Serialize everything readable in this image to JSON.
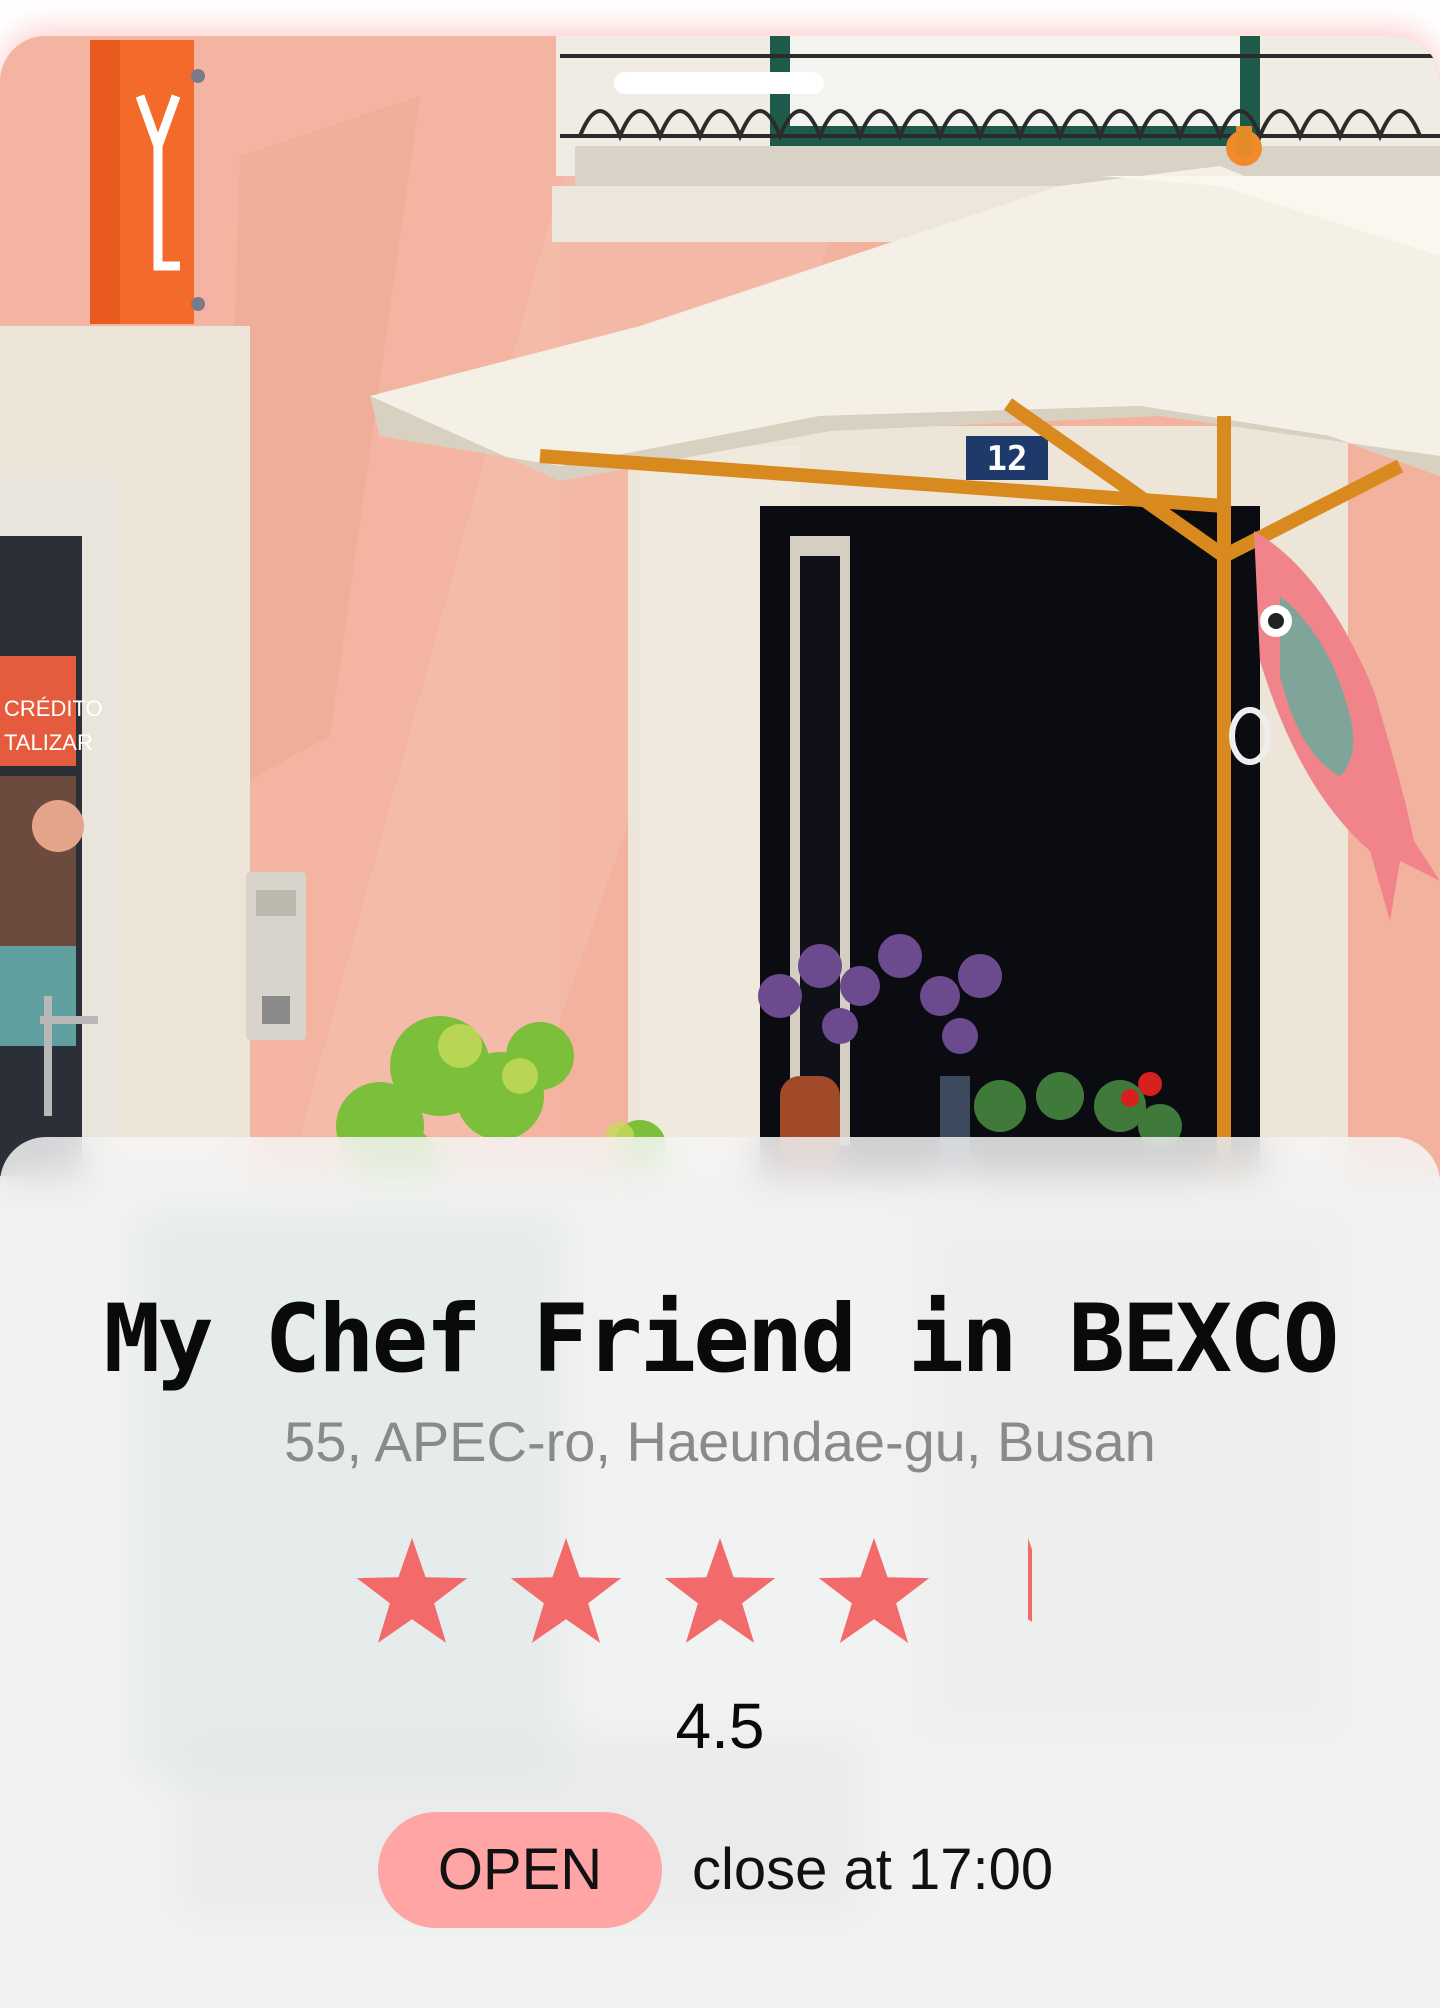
{
  "restaurant": {
    "name": "My Chef Friend in BEXCO",
    "address": "55, APEC-ro, Haeundae-gu, Busan",
    "rating": 4.5,
    "rating_label": "4.5",
    "rating_max": 5,
    "status": "OPEN",
    "closing_text": "close at 17:00"
  },
  "photo": {
    "sign_text": "CRÉDITO TALIZAR",
    "door_number": "12"
  },
  "colors": {
    "star": "#f26a6a",
    "badge": "#ffa5a5",
    "wall": "#f2b29e",
    "title": "#0a0a0a",
    "address": "#8a8a8a"
  },
  "icons": {
    "rating_star": "star-icon"
  }
}
